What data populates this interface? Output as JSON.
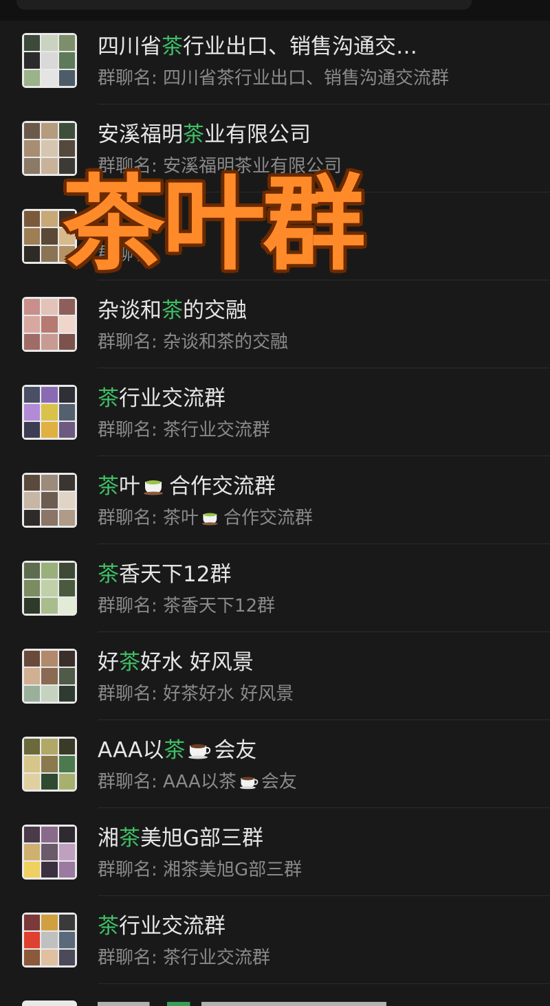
{
  "overlay_title": "茶叶群",
  "subtitle_prefix": "群聊名: ",
  "colors": {
    "background": "#191919",
    "highlight": "#3fbf66",
    "title_text": "#e6e6e6",
    "subtitle_text": "#8a8a8a",
    "overlay": "#ff8a2a"
  },
  "groups": [
    {
      "title_pre": "四川省",
      "title_hl": "茶",
      "title_post": "行业出口、销售沟通交…",
      "subtitle": "四川省茶行业出口、销售沟通交流群"
    },
    {
      "title_pre": "安溪福明",
      "title_hl": "茶",
      "title_post": "业有限公司",
      "subtitle": "安溪福明茶业有限公司"
    },
    {
      "title_pre": "",
      "title_hl": "",
      "title_post": "",
      "subtitle": ""
    },
    {
      "title_pre": "杂谈和",
      "title_hl": "茶",
      "title_post": "的交融",
      "subtitle": "杂谈和茶的交融"
    },
    {
      "title_pre": "",
      "title_hl": "茶",
      "title_post": "行业交流群",
      "subtitle": "茶行业交流群"
    },
    {
      "title_pre": "",
      "title_hl": "茶",
      "title_post": "叶",
      "title_post2": "合作交流群",
      "cup": "green-tea",
      "subtitle": "茶叶",
      "subtitle_post": "合作交流群"
    },
    {
      "title_pre": "",
      "title_hl": "茶",
      "title_post": "香天下12群",
      "subtitle": "茶香天下12群"
    },
    {
      "title_pre": "好",
      "title_hl": "茶",
      "title_post": "好水 好风景",
      "subtitle": "好茶好水 好风景"
    },
    {
      "title_pre": "AAA以",
      "title_hl": "茶",
      "title_post": "",
      "title_post2": "会友",
      "cup": "coffee",
      "subtitle": "AAA以茶",
      "subtitle_post": "会友"
    },
    {
      "title_pre": "湘",
      "title_hl": "茶",
      "title_post": "美旭G部三群",
      "subtitle": "湘茶美旭G部三群"
    },
    {
      "title_pre": "",
      "title_hl": "茶",
      "title_post": "行业交流群",
      "subtitle": "茶行业交流群"
    }
  ]
}
